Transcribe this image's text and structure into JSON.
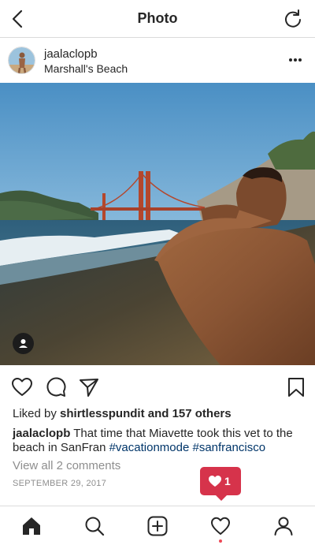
{
  "header": {
    "title": "Photo",
    "back_icon": "chevron-left-icon",
    "refresh_icon": "refresh-icon"
  },
  "post": {
    "username": "jaalaclopb",
    "location": "Marshall's Beach",
    "likes_prefix": "Liked by ",
    "liked_by": "shirtlesspundit",
    "likes_suffix": " and 157 others",
    "caption_user": "jaalaclopb",
    "caption_text": " That time that Miavette took this vet to the beach in SanFran ",
    "hashtag_1": "#vacationmode",
    "hashtag_2": "#sanfrancisco",
    "view_comments": "View all 2 comments",
    "date": "SEPTEMBER 29, 2017"
  },
  "notification": {
    "count": "1",
    "icon": "heart-icon",
    "color": "#d6334b"
  },
  "tabs": [
    "home-icon",
    "search-icon",
    "add-icon",
    "heart-icon",
    "profile-icon"
  ],
  "colors": {
    "hashtag": "#003569",
    "muted": "#8e8e8e",
    "text": "#262626"
  }
}
